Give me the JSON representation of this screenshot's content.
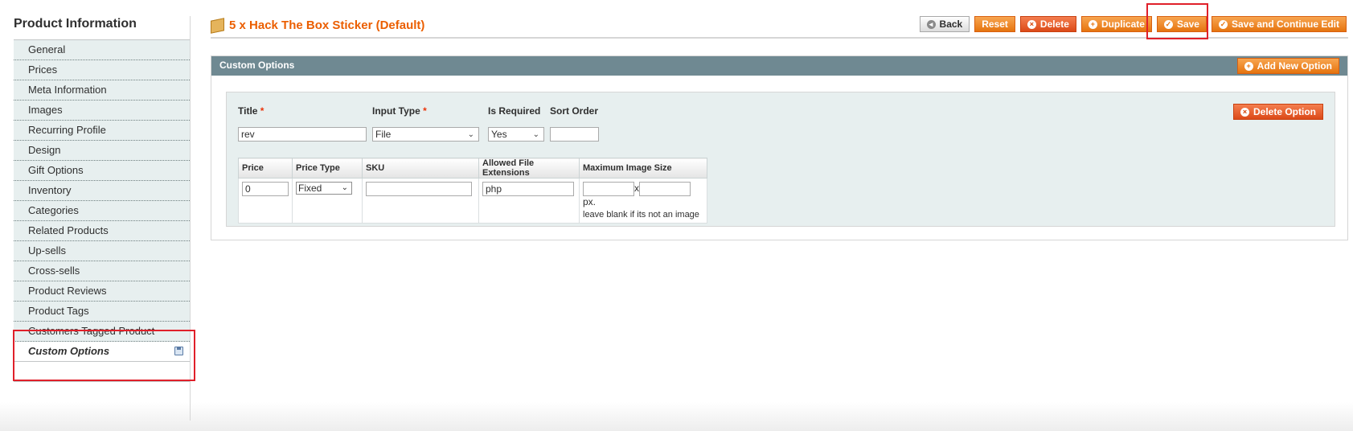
{
  "sidebar": {
    "title": "Product Information",
    "items": [
      {
        "label": "General"
      },
      {
        "label": "Prices"
      },
      {
        "label": "Meta Information"
      },
      {
        "label": "Images"
      },
      {
        "label": "Recurring Profile"
      },
      {
        "label": "Design"
      },
      {
        "label": "Gift Options"
      },
      {
        "label": "Inventory"
      },
      {
        "label": "Categories"
      },
      {
        "label": "Related Products"
      },
      {
        "label": "Up-sells"
      },
      {
        "label": "Cross-sells"
      },
      {
        "label": "Product Reviews"
      },
      {
        "label": "Product Tags"
      },
      {
        "label": "Customers Tagged Product"
      },
      {
        "label": "Custom Options",
        "active": true
      }
    ],
    "active_icon": "save-changes-icon"
  },
  "header": {
    "title": "5 x Hack The Box Sticker (Default)",
    "title_color": "#eb5e00",
    "icon": "product-box-icon"
  },
  "toolbar": {
    "back": "Back",
    "reset": "Reset",
    "delete": "Delete",
    "duplicate": "Duplicate",
    "save": "Save",
    "save_continue": "Save and Continue Edit"
  },
  "section": {
    "title": "Custom Options",
    "add_button": "Add New Option",
    "header_color": "#6f8992"
  },
  "option": {
    "title_label": "Title",
    "title_value": "rev",
    "input_type_label": "Input Type",
    "input_type_value": "File",
    "required_label": "Is Required",
    "required_value": "Yes",
    "sort_order_label": "Sort Order",
    "sort_order_value": "",
    "required_mark": "*",
    "delete_button": "Delete Option"
  },
  "file_row": {
    "headers": [
      "Price",
      "Price Type",
      "SKU",
      "Allowed File Extensions",
      "Maximum Image Size"
    ],
    "price": "0",
    "price_type": "Fixed",
    "sku": "",
    "extensions": "php",
    "max_width": "",
    "max_height": "",
    "size_separator": "x",
    "size_unit": "px.",
    "size_note": "leave blank if its not an image"
  },
  "colors": {
    "accent": "#e5740f",
    "highlight": "#e0202a"
  }
}
